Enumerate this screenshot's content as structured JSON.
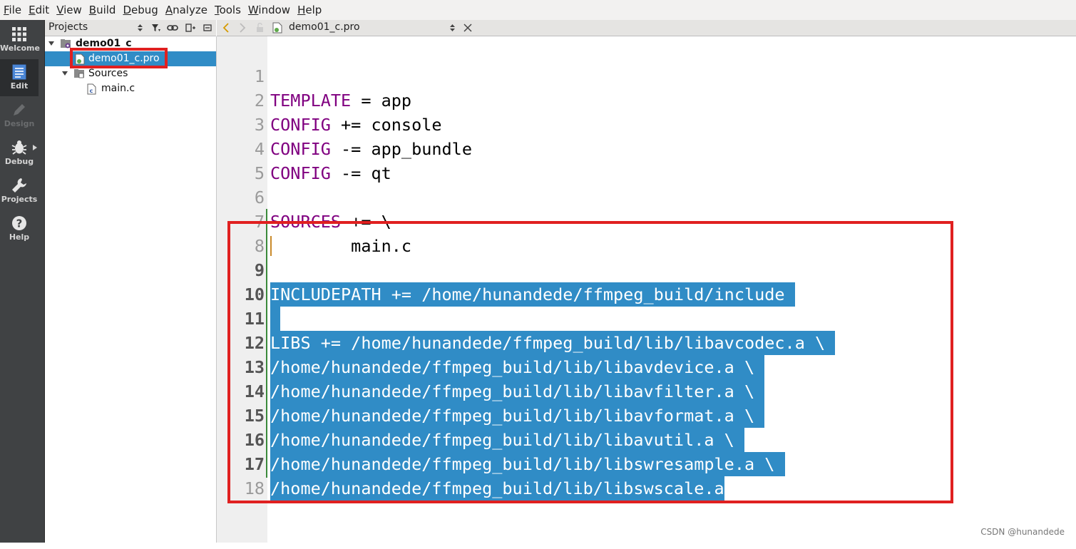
{
  "menubar": {
    "items": [
      {
        "label": "File",
        "key": "F",
        "rest": "ile"
      },
      {
        "label": "Edit",
        "key": "E",
        "rest": "dit"
      },
      {
        "label": "View",
        "key": "V",
        "rest": "iew"
      },
      {
        "label": "Build",
        "key": "B",
        "rest": "uild"
      },
      {
        "label": "Debug",
        "key": "D",
        "rest": "ebug"
      },
      {
        "label": "Analyze",
        "key": "A",
        "rest": "nalyze"
      },
      {
        "label": "Tools",
        "key": "T",
        "rest": "ools"
      },
      {
        "label": "Window",
        "key": "W",
        "rest": "indow"
      },
      {
        "label": "Help",
        "key": "H",
        "rest": "elp"
      }
    ]
  },
  "modes": [
    {
      "label": "Welcome",
      "icon": "grid-icon",
      "state": "normal"
    },
    {
      "label": "Edit",
      "icon": "document-icon",
      "state": "active"
    },
    {
      "label": "Design",
      "icon": "pencil-icon",
      "state": "disabled"
    },
    {
      "label": "Debug",
      "icon": "bug-icon",
      "state": "normal"
    },
    {
      "label": "Projects",
      "icon": "wrench-icon",
      "state": "normal"
    },
    {
      "label": "Help",
      "icon": "question-icon",
      "state": "normal"
    }
  ],
  "projects_pane": {
    "title": "Projects",
    "tree": {
      "project": "demo01_c",
      "pro_file": "demo01_c.pro",
      "sources_folder": "Sources",
      "source_file": "main.c"
    }
  },
  "editor": {
    "tab_title": "demo01_c.pro",
    "lines": [
      {
        "n": "1",
        "kw": "TEMPLATE",
        "rest": " = app"
      },
      {
        "n": "2",
        "kw": "CONFIG",
        "rest": " += console"
      },
      {
        "n": "3",
        "kw": "CONFIG",
        "rest": " -= app_bundle"
      },
      {
        "n": "4",
        "kw": "CONFIG",
        "rest": " -= qt"
      },
      {
        "n": "5",
        "kw": "",
        "rest": ""
      },
      {
        "n": "6",
        "kw": "SOURCES",
        "rest": " += \\"
      },
      {
        "n": "7",
        "kw": "",
        "rest": "        main.c"
      },
      {
        "n": "8",
        "kw": "",
        "rest": ""
      },
      {
        "n": "9",
        "sel": "INCLUDEPATH += /home/hunandede/ffmpeg_build/include "
      },
      {
        "n": "10",
        "sel": " "
      },
      {
        "n": "11",
        "sel": "LIBS += /home/hunandede/ffmpeg_build/lib/libavcodec.a \\ "
      },
      {
        "n": "12",
        "sel": "/home/hunandede/ffmpeg_build/lib/libavdevice.a \\ "
      },
      {
        "n": "13",
        "sel": "/home/hunandede/ffmpeg_build/lib/libavfilter.a \\ "
      },
      {
        "n": "14",
        "sel": "/home/hunandede/ffmpeg_build/lib/libavformat.a \\ "
      },
      {
        "n": "15",
        "sel": "/home/hunandede/ffmpeg_build/lib/libavutil.a \\ "
      },
      {
        "n": "16",
        "sel": "/home/hunandede/ffmpeg_build/lib/libswresample.a \\ "
      },
      {
        "n": "17",
        "sel": "/home/hunandede/ffmpeg_build/lib/libswscale.a"
      },
      {
        "n": "18",
        "kw": "",
        "rest": ""
      }
    ]
  },
  "watermark": "CSDN @hunandede",
  "colors": {
    "selection": "#308cc6",
    "keyword": "#800080",
    "annotation_red": "#e02020",
    "modebar_bg": "#404244"
  }
}
